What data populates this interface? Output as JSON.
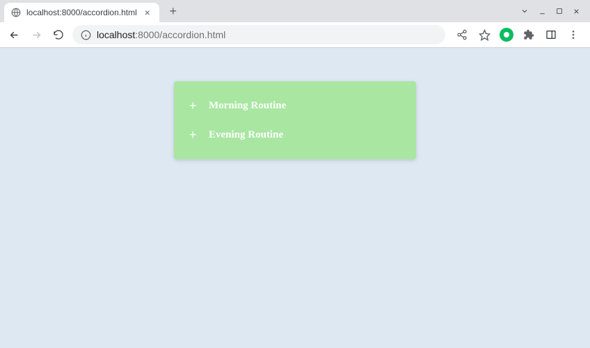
{
  "browser": {
    "tab": {
      "title": "localhost:8000/accordion.html"
    },
    "url": {
      "host": "localhost",
      "port_path": ":8000/accordion.html"
    }
  },
  "page": {
    "accordion": {
      "items": [
        {
          "toggle": "+",
          "label": "Morning Routine"
        },
        {
          "toggle": "+",
          "label": "Evening Routine"
        }
      ]
    }
  }
}
